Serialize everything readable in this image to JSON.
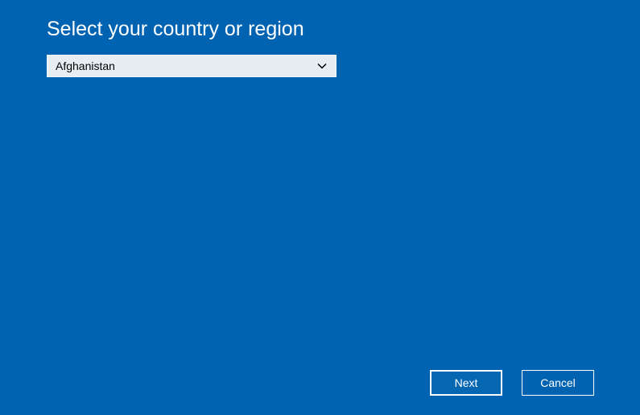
{
  "heading": "Select your country or region",
  "dropdown": {
    "selected": "Afghanistan"
  },
  "buttons": {
    "next": "Next",
    "cancel": "Cancel"
  }
}
